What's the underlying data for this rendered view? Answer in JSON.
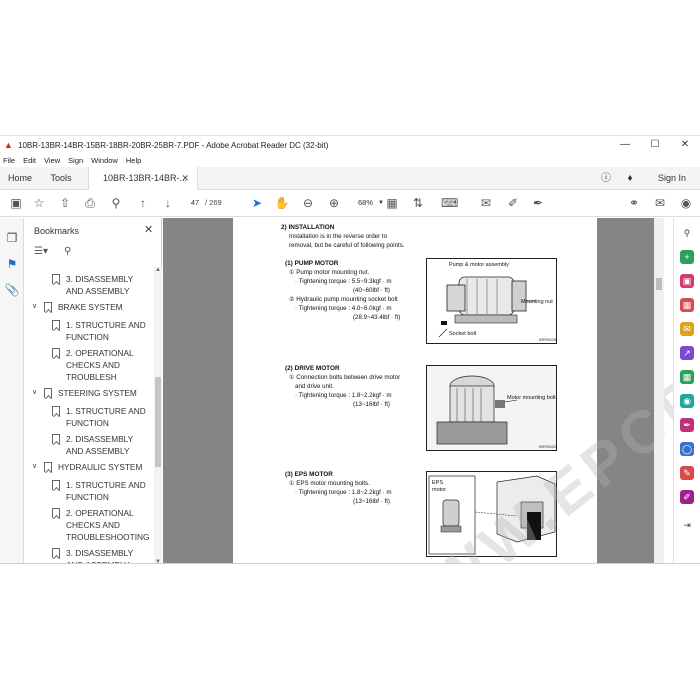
{
  "window": {
    "title": "10BR-13BR-14BR-15BR-18BR-20BR-25BR-7.PDF - Adobe Acrobat Reader DC (32-bit)",
    "menu": [
      "File",
      "Edit",
      "View",
      "Sign",
      "Window",
      "Help"
    ]
  },
  "tabs": {
    "home": "Home",
    "tools": "Tools",
    "doc": "10BR-13BR-14BR-...",
    "sign_in": "Sign In"
  },
  "toolbar": {
    "page_current": "47",
    "page_total": "/  269",
    "zoom": "68%"
  },
  "bookmarks": {
    "title": "Bookmarks",
    "items": [
      {
        "label_lines": [
          "3. DISASSEMBLY",
          "AND ASSEMBLY"
        ],
        "level": 2
      },
      {
        "label_lines": [
          "BRAKE SYSTEM"
        ],
        "level": 1
      },
      {
        "label_lines": [
          "1. STRUCTURE AND",
          "FUNCTION"
        ],
        "level": 2
      },
      {
        "label_lines": [
          "2. OPERATIONAL",
          "CHECKS AND",
          "TROUBLESH"
        ],
        "level": 2
      },
      {
        "label_lines": [
          "STEERING SYSTEM"
        ],
        "level": 1
      },
      {
        "label_lines": [
          "1. STRUCTURE AND",
          "FUNCTION"
        ],
        "level": 2
      },
      {
        "label_lines": [
          "2. DISASSEMBLY",
          "AND ASSEMBLY"
        ],
        "level": 2
      },
      {
        "label_lines": [
          "HYDRAULIC SYSTEM"
        ],
        "level": 1
      },
      {
        "label_lines": [
          "1. STRUCTURE AND",
          "FUNCTION"
        ],
        "level": 2
      },
      {
        "label_lines": [
          "2. OPERATIONAL",
          "CHECKS AND",
          "TROUBLESHOOTING"
        ],
        "level": 2
      },
      {
        "label_lines": [
          "3. DISASSEMBLY",
          "AND ASSEMBLY"
        ],
        "level": 2
      }
    ]
  },
  "document": {
    "installation_head": "2) INSTALLATION",
    "installation_line1": "Installation is in the reverse order to",
    "installation_line2": "removal, but be careful of following points.",
    "pump": {
      "head": "(1) PUMP MOTOR",
      "l1": "① Pump motor mounting nut.",
      "l2": "· Tightening torque : 5.5~9.3kgf · m",
      "l3": "(40~60lbf · ft)",
      "l4": "② Hydraulic pump mounting socket bolt",
      "l5": "· Tightening torque : 4.0~6.0kgf · m",
      "l6": "(28.9~43.4lbf · ft)",
      "fig_title": "Pump & motor assembly",
      "fig_nut": "Mounting nut",
      "fig_bolt": "Socket bolt",
      "fig_code": "BRP8026"
    },
    "drive": {
      "head": "(2) DRIVE MOTOR",
      "l1": "① Connection bolts between drive motor",
      "l2": "and drive unit.",
      "l3": "· Tightening torque : 1.8~2.2kgf · m",
      "l4": "(13~16lbf · ft)",
      "fig_bolt": "Motor mounting bolt",
      "fig_code": "BRP8022"
    },
    "eps": {
      "head": "(3) EPS MOTOR",
      "l1": "① EPS motor mounting bolts.",
      "l2": "· Tightening torque : 1.8~2.2kgf · m",
      "l3": "(13~16lbf · ft)",
      "fig_label1": "EPS",
      "fig_label2": "motor"
    },
    "watermark": "WWW.EPCDEPT.COM"
  }
}
